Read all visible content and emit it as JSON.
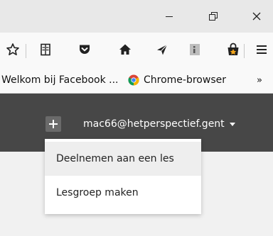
{
  "window": {
    "icons": [
      "minimize-icon",
      "maximize-icon",
      "close-icon"
    ]
  },
  "toolbar": {
    "icons": [
      "star-icon",
      "reading-list-icon",
      "pocket-icon",
      "home-icon",
      "send-icon",
      "reader-icon",
      "shopping-bag-icon",
      "menu-icon"
    ]
  },
  "bookmarks": {
    "items": [
      {
        "label": "Welkom bij Facebook ..."
      },
      {
        "label": "Chrome-browser",
        "icon": "chrome-icon"
      }
    ],
    "overflow": "»"
  },
  "header": {
    "account": "mac66@hetperspectief.gent",
    "background": "#474747"
  },
  "menu": {
    "items": [
      {
        "label": "Deelnemen aan een les"
      },
      {
        "label": "Lesgroep maken"
      }
    ]
  }
}
